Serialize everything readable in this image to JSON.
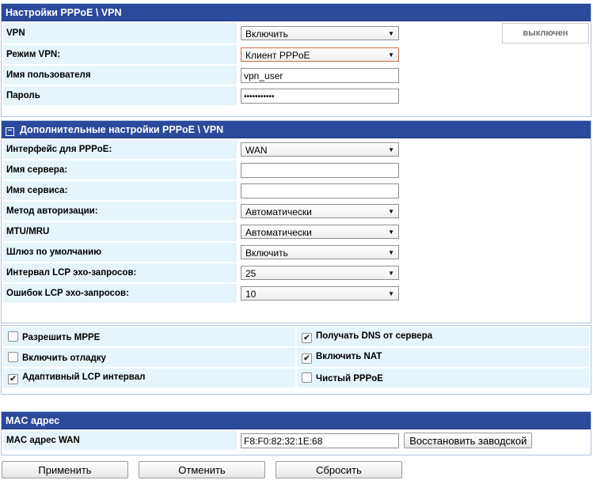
{
  "vpn_settings": {
    "title": "Настройки PPPoE \\ VPN",
    "vpn_label": "VPN",
    "vpn_value": "Включить",
    "vpn_state": "выключен",
    "mode_label": "Режим VPN:",
    "mode_value": "Клиент PPPoE",
    "username_label": "Имя пользователя",
    "username_value": "vpn_user",
    "password_label": "Пароль",
    "password_value": "•••••••••••"
  },
  "advanced": {
    "toggle_icon": "minus-square",
    "title": "Дополнительные настройки PPPoE \\ VPN",
    "rows": [
      {
        "label": "Интерфейс для PPPoE:",
        "type": "select",
        "value": "WAN"
      },
      {
        "label": "Имя сервера:",
        "type": "input",
        "value": ""
      },
      {
        "label": "Имя сервиса:",
        "type": "input",
        "value": ""
      },
      {
        "label": "Метод авторизации:",
        "type": "select",
        "value": "Автоматически"
      },
      {
        "label": "MTU/MRU",
        "type": "select",
        "value": "Автоматически"
      },
      {
        "label": "Шлюз по умолчанию",
        "type": "select",
        "value": "Включить"
      },
      {
        "label": "Интервал LCP эхо-запросов:",
        "type": "select",
        "value": "25"
      },
      {
        "label": "Ошибок LCP эхо-запросов:",
        "type": "select",
        "value": "10"
      }
    ]
  },
  "options": {
    "mppe_label": "Разрешить MPPE",
    "mppe_checked": false,
    "dns_label": "Получать DNS от сервера",
    "dns_checked": true,
    "debug_label": "Включить отладку",
    "debug_checked": false,
    "nat_label": "Включить NAT",
    "nat_checked": true,
    "adaptive_label": "Адаптивный LCP интервал",
    "adaptive_checked": true,
    "pure_label": "Чистый PPPoE",
    "pure_checked": false
  },
  "mac": {
    "title": "MAC адрес",
    "wan_label": "MAC адрес WAN",
    "wan_value": "F8:F0:82:32:1E:68",
    "restore_label": "Восстановить заводской"
  },
  "actions": {
    "apply_label": "Применить",
    "cancel_label": "Отменить",
    "reset_label": "Сбросить"
  }
}
